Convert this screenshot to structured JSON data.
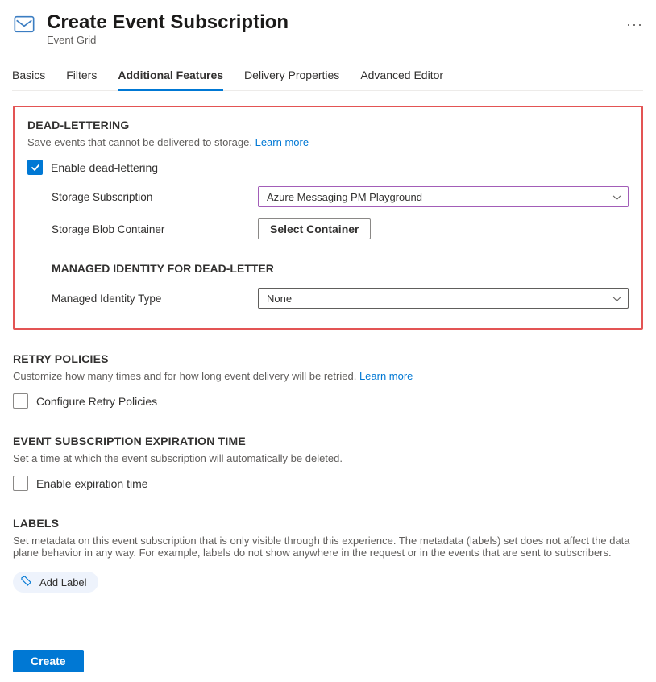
{
  "header": {
    "title": "Create Event Subscription",
    "subtitle": "Event Grid",
    "more": "···"
  },
  "tabs": [
    "Basics",
    "Filters",
    "Additional Features",
    "Delivery Properties",
    "Advanced Editor"
  ],
  "activeTab": "Additional Features",
  "deadLettering": {
    "title": "DEAD-LETTERING",
    "desc": "Save events that cannot be delivered to storage.",
    "learnMore": "Learn more",
    "enableLabel": "Enable dead-lettering",
    "storageSubLabel": "Storage Subscription",
    "storageSubValue": "Azure Messaging PM Playground",
    "storageBlobLabel": "Storage Blob Container",
    "selectContainerBtn": "Select Container",
    "managedTitle": "MANAGED IDENTITY FOR DEAD-LETTER",
    "managedLabel": "Managed Identity Type",
    "managedValue": "None"
  },
  "retry": {
    "title": "RETRY POLICIES",
    "desc": "Customize how many times and for how long event delivery will be retried.",
    "learnMore": "Learn more",
    "checkboxLabel": "Configure Retry Policies"
  },
  "expiration": {
    "title": "EVENT SUBSCRIPTION EXPIRATION TIME",
    "desc": "Set a time at which the event subscription will automatically be deleted.",
    "checkboxLabel": "Enable expiration time"
  },
  "labels": {
    "title": "LABELS",
    "desc": "Set metadata on this event subscription that is only visible through this experience. The metadata (labels) set does not affect the data plane behavior in any way. For example, labels do not show anywhere in the request or in the events that are sent to subscribers.",
    "addBtn": "Add Label"
  },
  "footer": {
    "create": "Create"
  }
}
